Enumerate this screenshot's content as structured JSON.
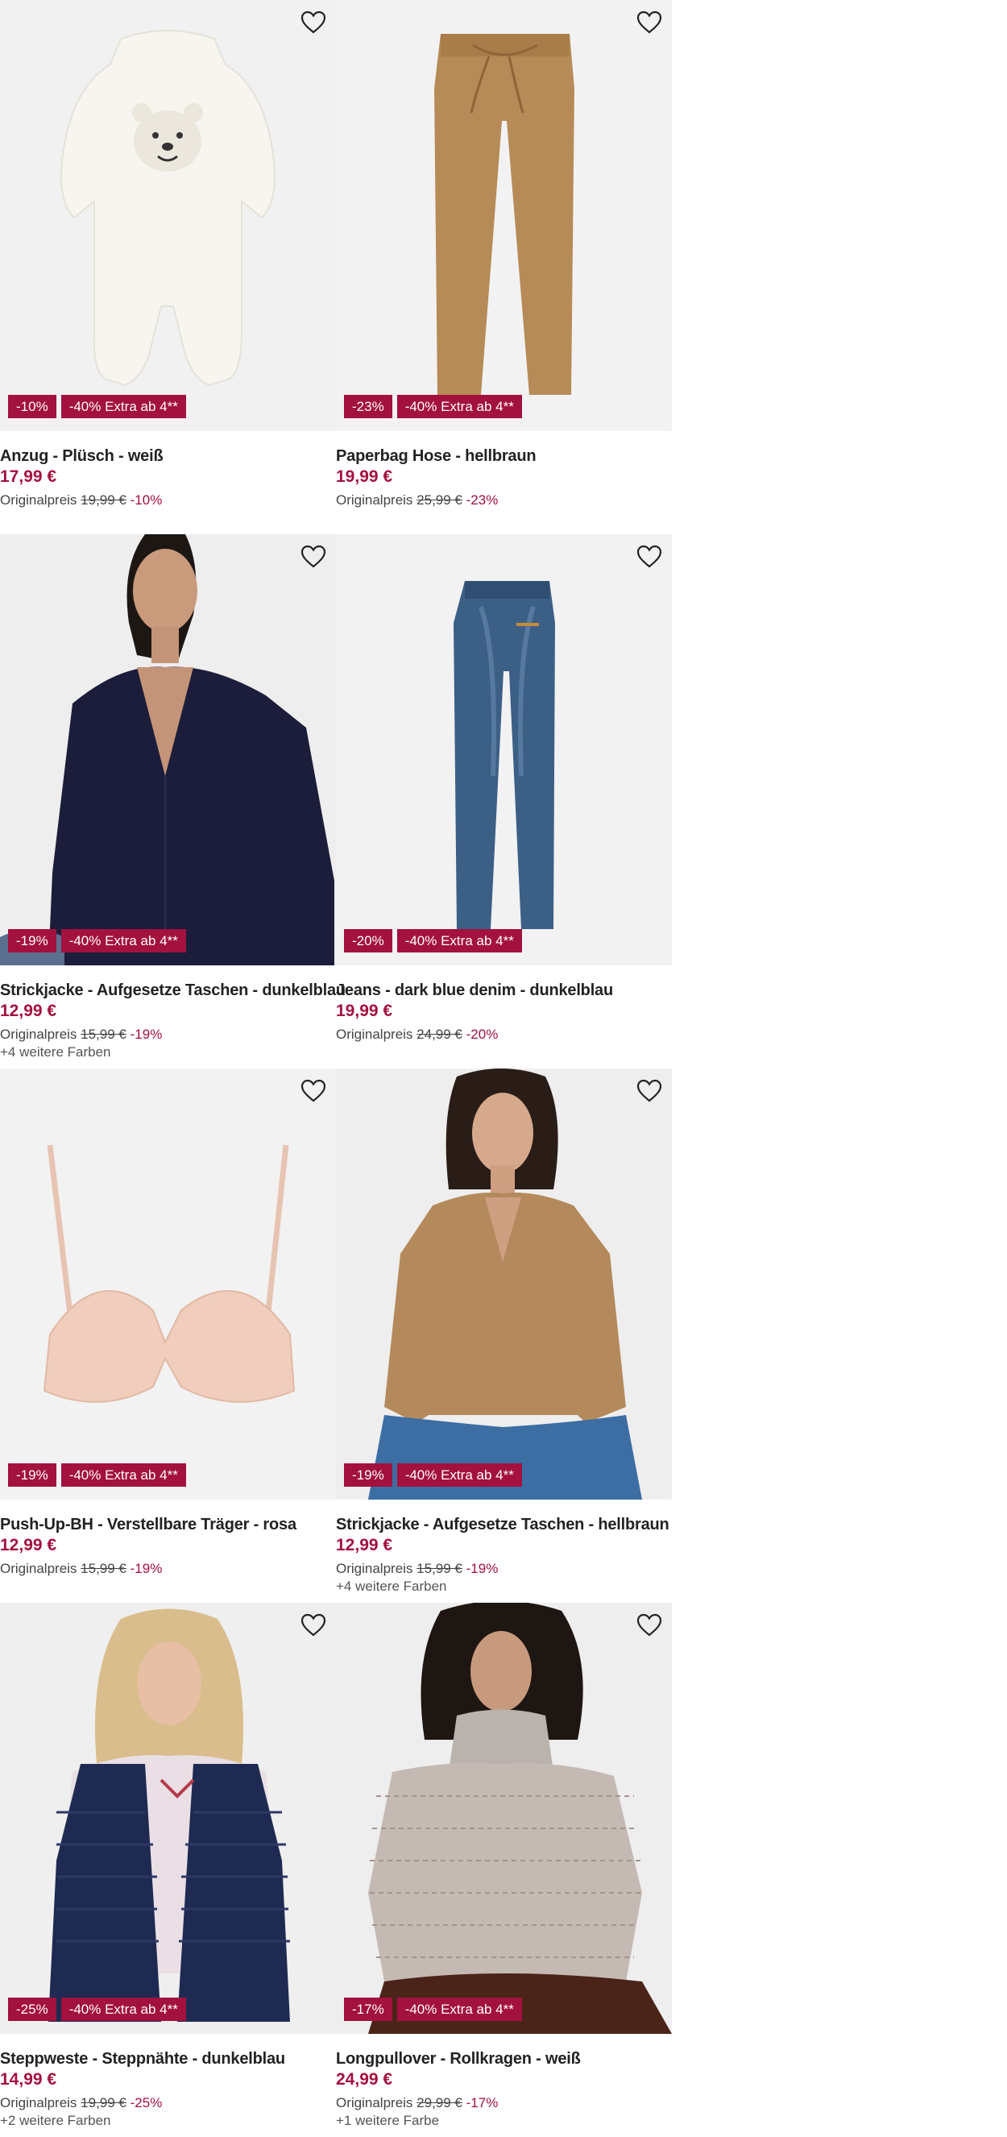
{
  "products": [
    {
      "title": "Anzug - Plüsch - weiß",
      "price": "17,99 €",
      "orig_label": "Originalpreis",
      "orig_price": "19,99 €",
      "discount_pct": "-10%",
      "badges": [
        "-10%",
        "-40% Extra ab 4**"
      ],
      "more_colors": "",
      "image": "plush-suit-image"
    },
    {
      "title": "Paperbag Hose - hellbraun",
      "price": "19,99 €",
      "orig_label": "Originalpreis",
      "orig_price": "25,99 €",
      "discount_pct": "-23%",
      "badges": [
        "-23%",
        "-40% Extra ab 4**"
      ],
      "more_colors": "",
      "image": "paperbag-pants-image"
    },
    {
      "title": "Strickjacke - Aufgesetze Taschen - dunkelblau",
      "price": "12,99 €",
      "orig_label": "Originalpreis",
      "orig_price": "15,99 €",
      "discount_pct": "-19%",
      "badges": [
        "-19%",
        "-40% Extra ab 4**"
      ],
      "more_colors": "+4 weitere Farben",
      "image": "cardigan-navy-image"
    },
    {
      "title": "Jeans - dark blue denim - dunkelblau",
      "price": "19,99 €",
      "orig_label": "Originalpreis",
      "orig_price": "24,99 €",
      "discount_pct": "-20%",
      "badges": [
        "-20%",
        "-40% Extra ab 4**"
      ],
      "more_colors": "",
      "image": "jeans-image"
    },
    {
      "title": "Push-Up-BH - Verstellbare Träger - rosa",
      "price": "12,99 €",
      "orig_label": "Originalpreis",
      "orig_price": "15,99 €",
      "discount_pct": "-19%",
      "badges": [
        "-19%",
        "-40% Extra ab 4**"
      ],
      "more_colors": "",
      "image": "push-up-bra-image"
    },
    {
      "title": "Strickjacke - Aufgesetze Taschen - hellbraun",
      "price": "12,99 €",
      "orig_label": "Originalpreis",
      "orig_price": "15,99 €",
      "discount_pct": "-19%",
      "badges": [
        "-19%",
        "-40% Extra ab 4**"
      ],
      "more_colors": "+4 weitere Farben",
      "image": "cardigan-brown-image"
    },
    {
      "title": "Steppweste - Steppnähte - dunkelblau",
      "price": "14,99 €",
      "orig_label": "Originalpreis",
      "orig_price": "19,99 €",
      "discount_pct": "-25%",
      "badges": [
        "-25%",
        "-40% Extra ab 4**"
      ],
      "more_colors": "+2 weitere Farben",
      "image": "quilted-vest-image"
    },
    {
      "title": "Longpullover - Rollkragen - weiß",
      "price": "24,99 €",
      "orig_label": "Originalpreis",
      "orig_price": "29,99 €",
      "discount_pct": "-17%",
      "badges": [
        "-17%",
        "-40% Extra ab 4**"
      ],
      "more_colors": "+1 weitere Farbe",
      "image": "turtleneck-sweater-image"
    }
  ],
  "icons": {
    "wishlist": "heart-outline-icon"
  },
  "colors": {
    "accent": "#a3113e",
    "media_bg": "#f2f2f2",
    "text": "#222222"
  }
}
